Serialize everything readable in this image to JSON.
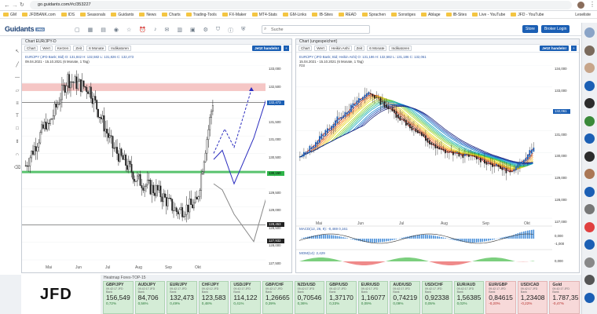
{
  "browser": {
    "url": "go.guidants.com/#c/353227",
    "bookmarks": [
      "GM",
      "JFDBANK.com",
      "IDS",
      "Seasonals",
      "Guidants",
      "News",
      "Charts",
      "Trading-Tools",
      "FX-Maker",
      "MT4-Stats",
      "GM-Links",
      "IB-Sites",
      "READ",
      "Sprachen",
      "Sonstiges",
      "Ablage",
      "IB-Sites",
      "Live - YouTube",
      "JFD - YouTube"
    ],
    "other_bookmarks": "Leseliste"
  },
  "app": {
    "logo": "Guidants",
    "logo_badge": "PRO",
    "search_placeholder": "Suche",
    "store_label": "Store",
    "login_label": "Broker Login"
  },
  "chart_left": {
    "title": "Chart EUR/JPY-D",
    "toolbar": [
      "Chart",
      "Wert",
      "Kerzen",
      "Zeit",
      "6 Monate",
      "Indikatoren"
    ],
    "trade_label": "Jetzt handeln!",
    "legend": "EUR/JPY (JFD Bank; Bid) O: 131,842  H: 132,582  L: 131,826  C: 132,473",
    "range": "09.04.2021 - 15.10.2021 (6 Monate, 1 Tag)",
    "x_labels": [
      "Mai",
      "Jun",
      "Jul",
      "Aug",
      "Sep",
      "Okt"
    ],
    "y_labels": [
      "133,000",
      "132,500",
      "132,000",
      "131,500",
      "131,000",
      "130,500",
      "130,000",
      "129,500",
      "129,000",
      "128,500",
      "128,000",
      "127,500"
    ]
  },
  "chart_right": {
    "title": "Chart (ungespeichert)",
    "toolbar": [
      "Chart",
      "Wert",
      "Heikin Ashi",
      "Zeit",
      "6 Monate",
      "Indikatoren"
    ],
    "trade_label": "Jetzt handeln!",
    "legend": "EUR/JPY (JFD Bank; Bid; Heikin Ashi) O: 131,186  H: 132,582  L: 131,186  C: 132,061",
    "range": "15.04.2021 - 15.10.2021 (6 Monate, 1 Tag)",
    "indicator": "RSI",
    "macd_label": "MACD(12, 26, 9): -0,469  0,161",
    "mom_label": "MOM(14): 2,429",
    "x_labels": [
      "Mai",
      "Jun",
      "Jul",
      "Aug",
      "Sep",
      "Okt"
    ],
    "y_labels": [
      "134,000",
      "133,000",
      "132,000",
      "131,000",
      "130,000",
      "129,000",
      "128,000",
      "127,000"
    ],
    "macd_ticks": [
      "0,000",
      "-1,000"
    ],
    "mom_ticks": [
      "0,000"
    ]
  },
  "heatmap": {
    "title": "Heatmap Forex-TOP-15",
    "tiles": [
      {
        "name": "GBP/JPY",
        "sub": "09.42:17 JFD Bank",
        "value": "156,549",
        "change": "0,72%",
        "neg": false
      },
      {
        "name": "AUD/JPY",
        "sub": "09.42:17 JFD Bank",
        "value": "84,706",
        "change": "0,56%",
        "neg": false
      },
      {
        "name": "EUR/JPY",
        "sub": "09.42:17 JFD Bank",
        "value": "132,473",
        "change": "0,49%",
        "neg": false
      },
      {
        "name": "CHF/JPY",
        "sub": "09.42:12 JFD Bank",
        "value": "123,583",
        "change": "0,48%",
        "neg": false
      },
      {
        "name": "USD/JPY",
        "sub": "09.42:17 JFD Bank",
        "value": "114,122",
        "change": "0,41%",
        "neg": false
      },
      {
        "name": "GBP/CHF",
        "sub": "09.42:17 JFD Bank",
        "value": "1,26665",
        "change": "0,39%",
        "neg": false
      },
      {
        "name": "NZD/USD",
        "sub": "09.42:17 JFD Bank",
        "value": "0,70546",
        "change": "0,36%",
        "neg": false
      },
      {
        "name": "GBP/USD",
        "sub": "09.42:17 JFD Bank",
        "value": "1,37170",
        "change": "0,33%",
        "neg": false
      },
      {
        "name": "EUR/USD",
        "sub": "09.42:17 JFD Bank",
        "value": "1,16077",
        "change": "0,09%",
        "neg": false
      },
      {
        "name": "AUD/USD",
        "sub": "09.42:17 JFD Bank",
        "value": "0,74219",
        "change": "0,09%",
        "neg": false
      },
      {
        "name": "USD/CHF",
        "sub": "09.42:17 JFD Bank",
        "value": "0,92338",
        "change": "0,05%",
        "neg": false
      },
      {
        "name": "EUR/AUD",
        "sub": "09.42:17 JFD Bank",
        "value": "1,56385",
        "change": "0,02%",
        "neg": false
      },
      {
        "name": "EUR/GBP",
        "sub": "09.42:17 JFD Bank",
        "value": "0,84615",
        "change": "-0,20%",
        "neg": true
      },
      {
        "name": "USD/CAD",
        "sub": "09.42:17 JFD Bank",
        "value": "1,23408",
        "change": "-0,22%",
        "neg": true
      },
      {
        "name": "Gold",
        "sub": "09.42:17 JFD Bank",
        "value": "1.787,35",
        "change": "-0,47%",
        "neg": true
      }
    ]
  },
  "left_price_tags": {
    "current": "132,473",
    "support": "130,150",
    "low1": "128,453",
    "low2": "127,932"
  },
  "right_price_tags": {
    "current": "132,061"
  },
  "brand": {
    "jfd": "JFD"
  },
  "colors": {
    "accent": "#1b5fb4",
    "positive": "#d4ecd6",
    "negative": "#f7d9d9",
    "support": "#2fb54a",
    "resistance": "#f2b8b6"
  }
}
